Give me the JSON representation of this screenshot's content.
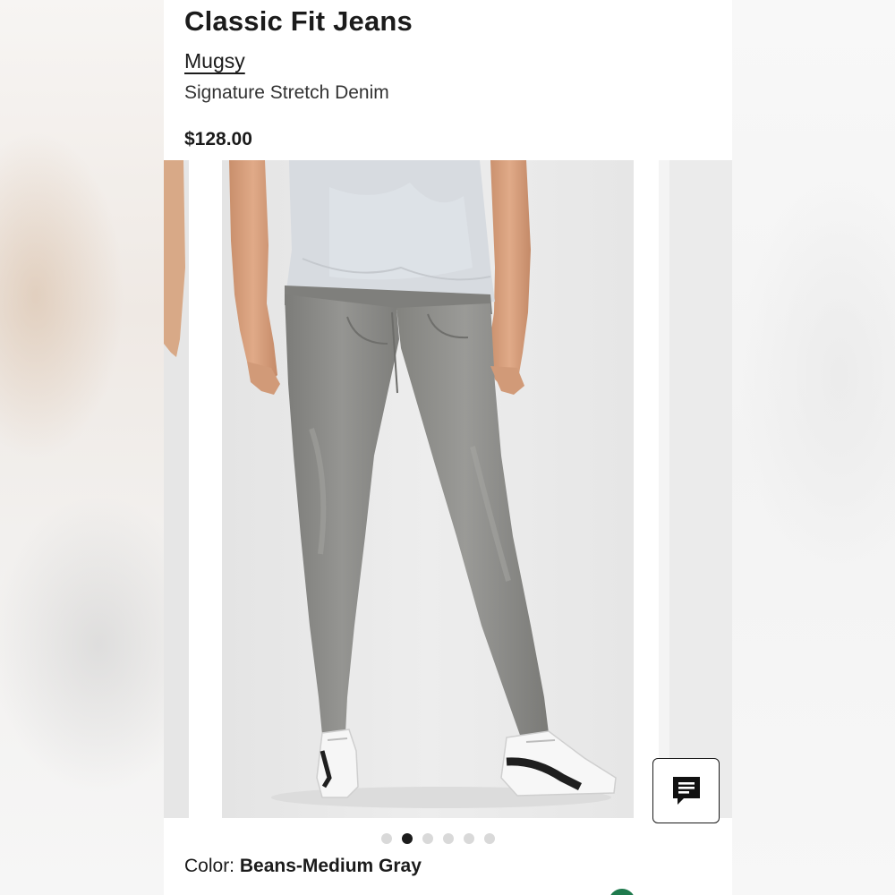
{
  "product": {
    "title": "Classic Fit Jeans",
    "brand": "Mugsy",
    "subtitle": "Signature Stretch Denim",
    "price": "$128.00"
  },
  "carousel": {
    "total_images": 6,
    "active_index": 1,
    "image_subject": "model wearing gray jeans, white t-shirt and white sneakers"
  },
  "color": {
    "label": "Color:",
    "value": "Beans-Medium Gray"
  },
  "chat": {
    "icon": "chat-bubble-icon"
  },
  "colors": {
    "text": "#1b1b1b",
    "denim": "#8a8a87",
    "accent_green": "#1f7a4d"
  }
}
